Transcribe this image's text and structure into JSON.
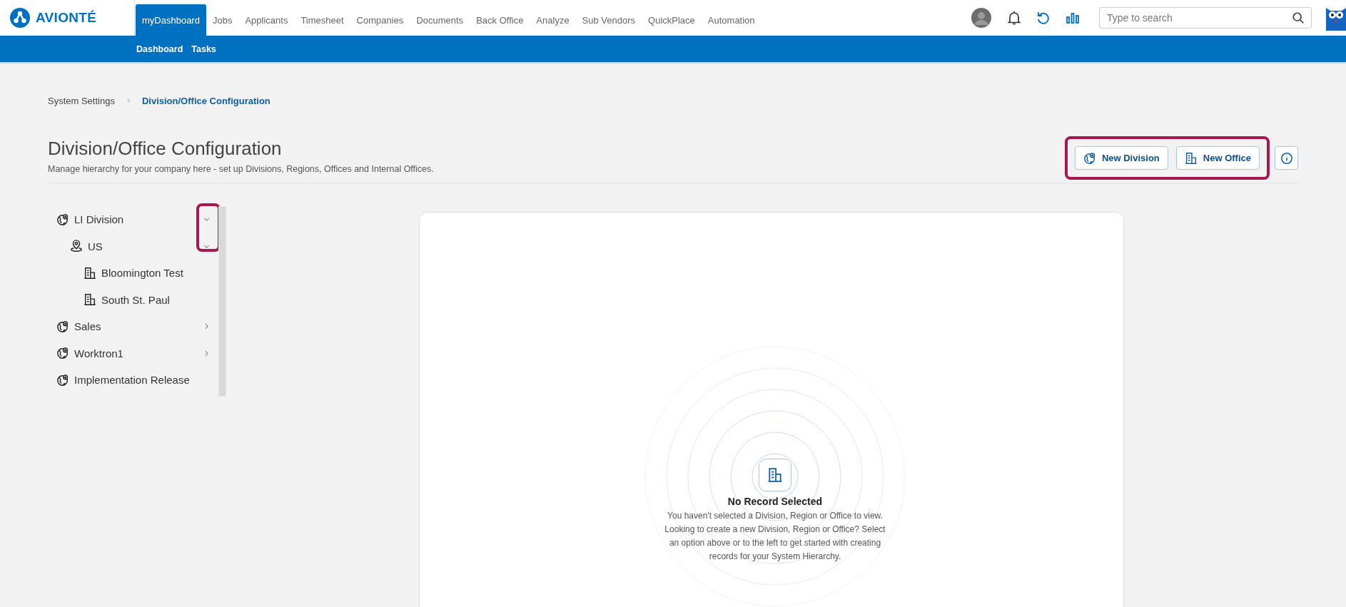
{
  "brand": {
    "name": "AVIONTÉ"
  },
  "nav": {
    "items": [
      {
        "label": "myDashboard",
        "selected": true
      },
      {
        "label": "Jobs",
        "selected": false
      },
      {
        "label": "Applicants",
        "selected": false
      },
      {
        "label": "Timesheet",
        "selected": false
      },
      {
        "label": "Companies",
        "selected": false
      },
      {
        "label": "Documents",
        "selected": false
      },
      {
        "label": "Back Office",
        "selected": false
      },
      {
        "label": "Analyze",
        "selected": false
      },
      {
        "label": "Sub Vendors",
        "selected": false
      },
      {
        "label": "QuickPlace",
        "selected": false
      },
      {
        "label": "Automation",
        "selected": false
      }
    ],
    "subnav": [
      "Dashboard",
      "Tasks"
    ],
    "search": {
      "placeholder": "Type to search"
    }
  },
  "breadcrumb": [
    {
      "label": "System Settings",
      "selected": false
    },
    {
      "label": "Division/Office Configuration",
      "selected": true
    }
  ],
  "header": {
    "title": "Division/Office Configuration",
    "subtitle": "Manage hierarchy for your company here - set up Divisions, Regions, Offices and Internal Offices.",
    "buttons": [
      {
        "kind": "division",
        "label": "New Division"
      },
      {
        "kind": "office",
        "label": "New Office"
      }
    ],
    "highlighted": true
  },
  "tree": {
    "chevrons_highlighted": true,
    "items": [
      {
        "kind": "division",
        "label": "LI Division",
        "expanded": true,
        "children": [
          {
            "kind": "region",
            "label": "US",
            "expanded": true,
            "children": [
              {
                "kind": "office",
                "label": "Bloomington Test"
              },
              {
                "kind": "office",
                "label": "South St. Paul"
              }
            ]
          }
        ]
      },
      {
        "kind": "division",
        "label": "Sales",
        "expanded": false
      },
      {
        "kind": "division",
        "label": "Worktron1",
        "expanded": false
      },
      {
        "kind": "division",
        "label": "Implementation Release"
      }
    ]
  },
  "empty_state": {
    "title": "No Record Selected",
    "message": "You haven't selected a Division, Region or Office to view. Looking to create a new Division, Region or Office? Select an option above or to the left to get started with creating records for your System Hierarchy."
  }
}
